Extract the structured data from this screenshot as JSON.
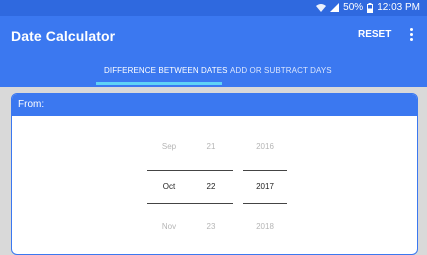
{
  "status_bar": {
    "battery": "50%",
    "time": "12:03 PM",
    "icons": [
      "wifi-icon",
      "signal-icon",
      "battery-icon"
    ]
  },
  "app_bar": {
    "title": "Date Calculator",
    "reset_label": "RESET",
    "more_icon": "more-vert-icon"
  },
  "tabs": [
    {
      "label": "DIFFERENCE BETWEEN DATES",
      "selected": true
    },
    {
      "label": "ADD OR SUBTRACT DAYS",
      "selected": false
    }
  ],
  "from_card": {
    "header": "From:",
    "picker": {
      "month": {
        "prev": "Sep",
        "current": "Oct",
        "next": "Nov"
      },
      "day": {
        "prev": "21",
        "current": "22",
        "next": "23"
      },
      "year": {
        "prev": "2016",
        "current": "2017",
        "next": "2018"
      }
    }
  },
  "colors": {
    "primary": "#3b78f0",
    "status_bar": "#2f69df",
    "tab_indicator": "#5fd2f7"
  }
}
